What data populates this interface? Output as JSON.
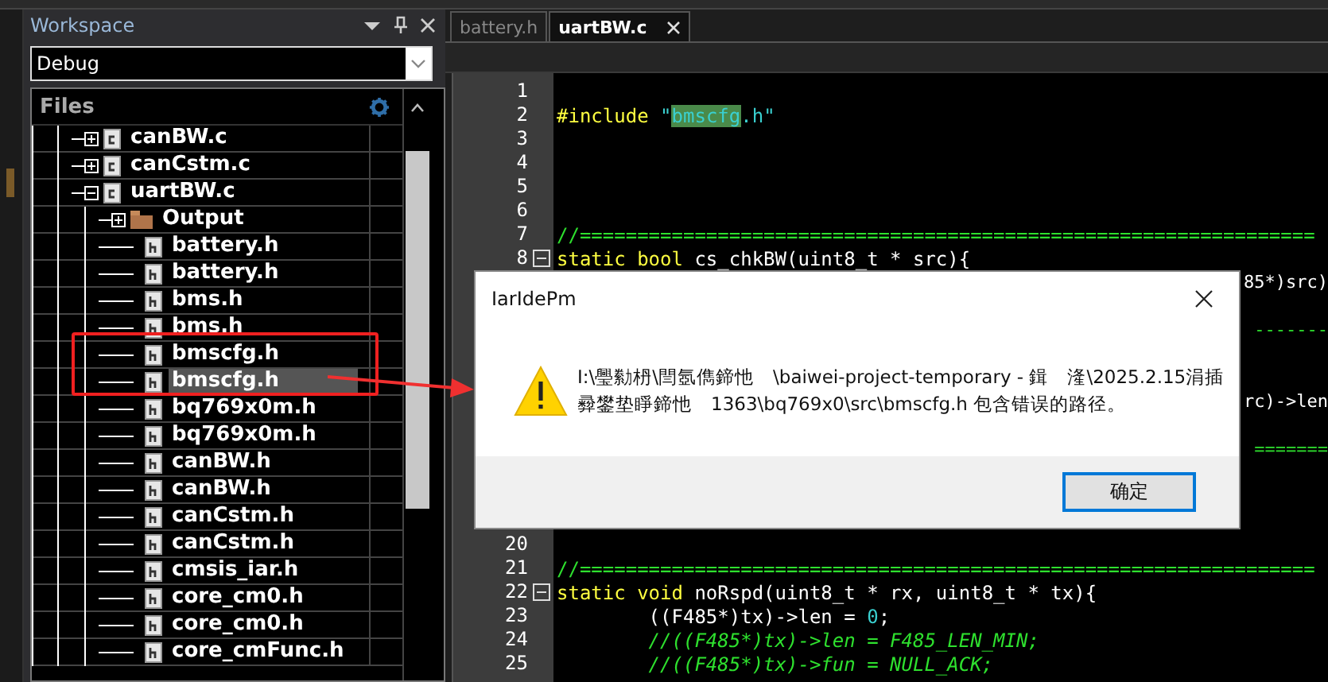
{
  "workspace": {
    "title": "Workspace",
    "configuration": "Debug",
    "files_header": "Files",
    "tree": [
      {
        "name": "canBW.c",
        "kind": "c-file",
        "expanded": false,
        "selected": false
      },
      {
        "name": "canCstm.c",
        "kind": "c-file",
        "expanded": false,
        "selected": false
      },
      {
        "name": "uartBW.c",
        "kind": "c-file",
        "expanded": true,
        "selected": false,
        "children": [
          {
            "name": "Output",
            "kind": "folder",
            "expanded": false,
            "selected": false
          },
          {
            "name": "battery.h",
            "kind": "h-file",
            "selected": false
          },
          {
            "name": "battery.h",
            "kind": "h-file",
            "selected": false
          },
          {
            "name": "bms.h",
            "kind": "h-file",
            "selected": false
          },
          {
            "name": "bms.h",
            "kind": "h-file",
            "selected": false
          },
          {
            "name": "bmscfg.h",
            "kind": "h-file",
            "selected": false
          },
          {
            "name": "bmscfg.h",
            "kind": "h-file",
            "selected": true
          },
          {
            "name": "bq769x0m.h",
            "kind": "h-file",
            "selected": false
          },
          {
            "name": "bq769x0m.h",
            "kind": "h-file",
            "selected": false
          },
          {
            "name": "canBW.h",
            "kind": "h-file",
            "selected": false
          },
          {
            "name": "canBW.h",
            "kind": "h-file",
            "selected": false
          },
          {
            "name": "canCstm.h",
            "kind": "h-file",
            "selected": false
          },
          {
            "name": "canCstm.h",
            "kind": "h-file",
            "selected": false
          },
          {
            "name": "cmsis_iar.h",
            "kind": "h-file",
            "selected": false
          },
          {
            "name": "core_cm0.h",
            "kind": "h-file",
            "selected": false
          },
          {
            "name": "core_cm0.h",
            "kind": "h-file",
            "selected": false
          },
          {
            "name": "core_cmFunc.h",
            "kind": "h-file",
            "selected": false
          }
        ]
      }
    ]
  },
  "editor": {
    "tabs": [
      {
        "label": "battery.h",
        "selected": false
      },
      {
        "label": "uartBW.c",
        "selected": true
      }
    ],
    "lines_top": [
      {
        "number": "1"
      },
      {
        "number": "2",
        "segments": [
          {
            "kind": "preproc",
            "text": "#include "
          },
          {
            "kind": "string",
            "text": "\""
          },
          {
            "kind": "match",
            "text": "bmscfg"
          },
          {
            "kind": "string",
            "text": ".h\""
          }
        ]
      },
      {
        "number": "3"
      },
      {
        "number": "4"
      },
      {
        "number": "5"
      },
      {
        "number": "6"
      },
      {
        "number": "7",
        "segments": [
          {
            "kind": "comment",
            "text": "//================================================================"
          }
        ]
      },
      {
        "number": "8",
        "fold": true,
        "segments": [
          {
            "kind": "keyword",
            "text": "static bool"
          },
          {
            "kind": "plain",
            "text": " cs_chkBW(uint8_t * src){"
          }
        ]
      }
    ],
    "covered_fragments": [
      {
        "kind": "plain",
        "text": "85*)src)"
      },
      {
        "kind": "comment",
        "text": "-------"
      },
      {
        "kind": "plain",
        "text": "rc)->len"
      },
      {
        "kind": "comment",
        "text": "======="
      }
    ],
    "lines_bottom": [
      {
        "number": "20"
      },
      {
        "number": "21",
        "segments": [
          {
            "kind": "comment",
            "text": "//================================================================"
          }
        ]
      },
      {
        "number": "22",
        "fold": true,
        "segments": [
          {
            "kind": "keyword",
            "text": "static void"
          },
          {
            "kind": "plain",
            "text": " noRspd(uint8_t * rx, uint8_t * tx){"
          }
        ]
      },
      {
        "number": "23",
        "segments": [
          {
            "kind": "plain",
            "text": "        ((F485*)tx)->len = "
          },
          {
            "kind": "number",
            "text": "0"
          },
          {
            "kind": "plain",
            "text": ";"
          }
        ]
      },
      {
        "number": "24",
        "segments": [
          {
            "kind": "comment-italic",
            "text": "        //((F485*)tx)->len = F485_LEN_MIN;"
          }
        ]
      },
      {
        "number": "25",
        "segments": [
          {
            "kind": "comment-italic",
            "text": "        //((F485*)tx)->fun = NULL_ACK;"
          }
        ]
      }
    ]
  },
  "dialog": {
    "title": "IarIdePm",
    "message_lines": [
      "I:\\璺勬枬\\閆氬儁鍗忚　\\baiwei-project-temporary - 鍓　湰\\2025.2.15涓插",
      "彛鐢垫睜鍗忚　1363\\bq769x0\\src\\bmscfg.h 包含错误的路径。"
    ],
    "button": "确定"
  }
}
